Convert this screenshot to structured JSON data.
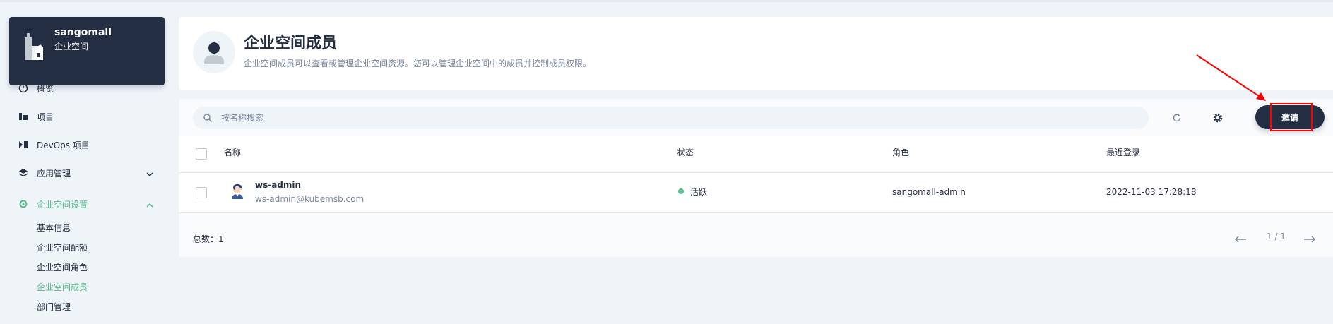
{
  "workspace": {
    "name": "sangomall",
    "subtitle": "企业空间"
  },
  "sidebar": {
    "items": [
      {
        "label": "概览"
      },
      {
        "label": "项目"
      },
      {
        "label": "DevOps 项目"
      },
      {
        "label": "应用管理"
      },
      {
        "label": "企业空间设置"
      }
    ],
    "settings_children": [
      "基本信息",
      "企业空间配额",
      "企业空间角色",
      "企业空间成员",
      "部门管理"
    ]
  },
  "header": {
    "title": "企业空间成员",
    "description": "企业空间成员可以查看或管理企业空间资源。您可以管理企业空间中的成员并控制成员权限。"
  },
  "toolbar": {
    "search_placeholder": "按名称搜索",
    "invite_label": "邀请"
  },
  "table": {
    "headers": {
      "name": "名称",
      "status": "状态",
      "role": "角色",
      "last_login": "最近登录"
    },
    "rows": [
      {
        "name": "ws-admin",
        "email": "ws-admin@kubemsb.com",
        "status": "活跃",
        "role": "sangomall-admin",
        "last_login": "2022-11-03 17:28:18"
      }
    ]
  },
  "footer": {
    "total_label": "总数：1",
    "page_indicator": "1 / 1"
  },
  "colors": {
    "accent": "#55bc8a",
    "dark": "#242e42",
    "annotation": "#ff0000"
  }
}
